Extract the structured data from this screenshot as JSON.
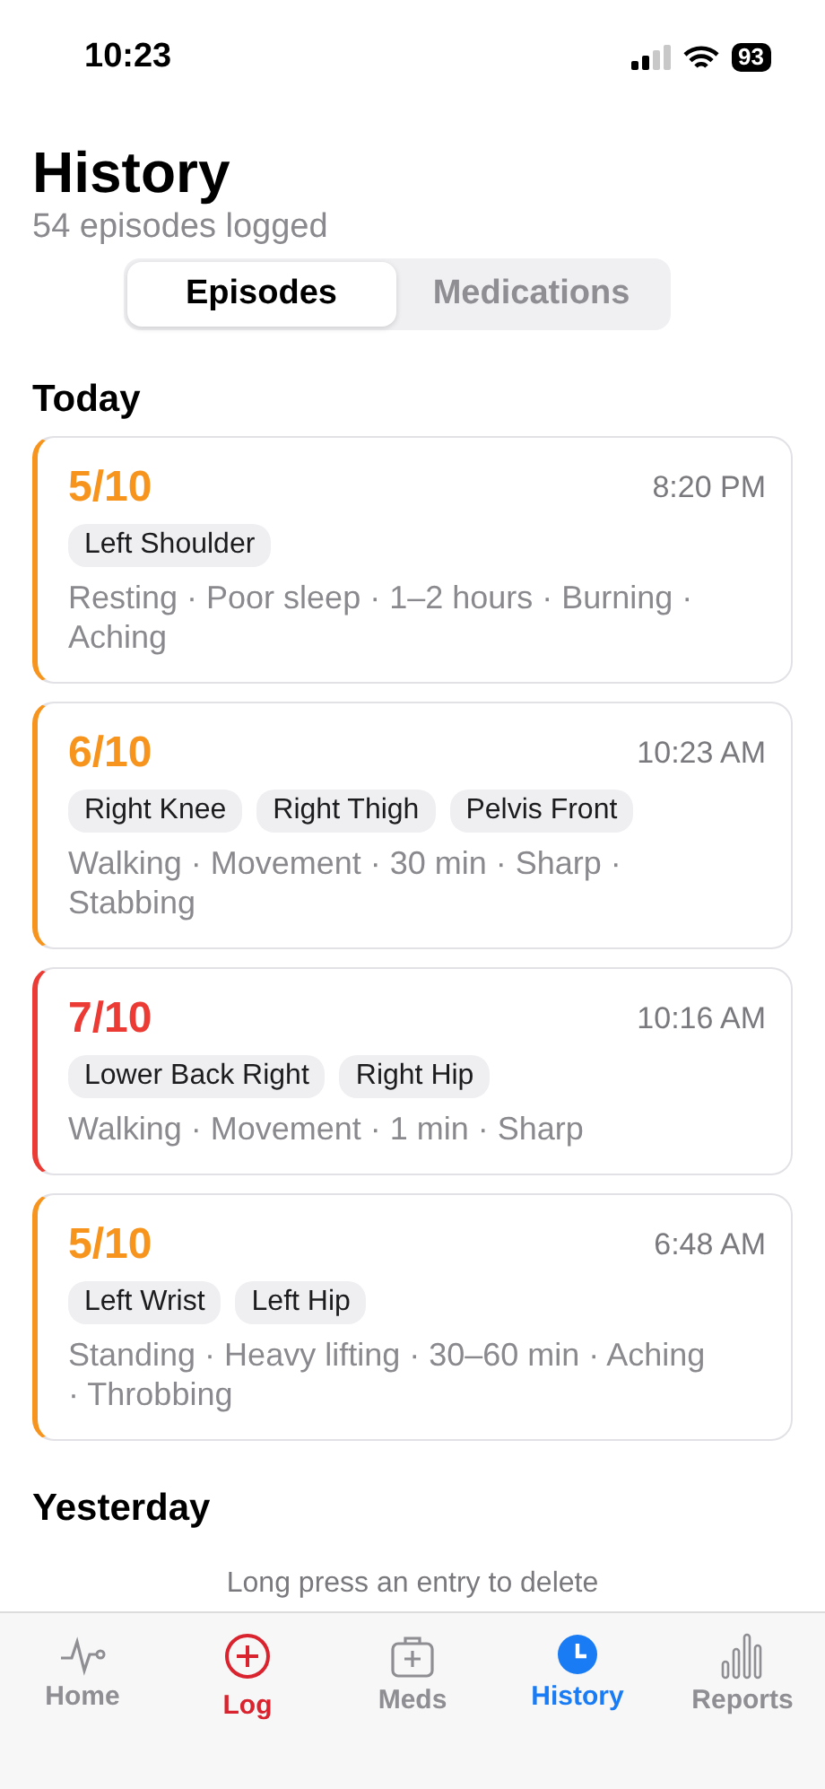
{
  "status_bar": {
    "time": "10:23",
    "battery": "93"
  },
  "header": {
    "title": "History",
    "subtitle": "54 episodes logged"
  },
  "segments": [
    {
      "label": "Episodes",
      "selected": true
    },
    {
      "label": "Medications",
      "selected": false
    }
  ],
  "sections": [
    {
      "title": "Today",
      "episodes": [
        {
          "score": "5/10",
          "color": "#f7941d",
          "time": "8:20 PM",
          "locations": [
            "Left Shoulder"
          ],
          "details": "Resting · Poor sleep · 1–2 hours · Burning · Aching"
        },
        {
          "score": "6/10",
          "color": "#f7941d",
          "time": "10:23 AM",
          "locations": [
            "Right Knee",
            "Right Thigh",
            "Pelvis Front"
          ],
          "details": "Walking · Movement · 30 min · Sharp · Stabbing"
        },
        {
          "score": "7/10",
          "color": "#eb3b34",
          "time": "10:16 AM",
          "locations": [
            "Lower Back Right",
            "Right Hip"
          ],
          "details": "Walking · Movement · 1 min · Sharp"
        },
        {
          "score": "5/10",
          "color": "#f7941d",
          "time": "6:48 AM",
          "locations": [
            "Left Wrist",
            "Left Hip"
          ],
          "details": "Standing · Heavy lifting · 30–60 min · Aching · Throbbing"
        }
      ]
    },
    {
      "title": "Yesterday"
    }
  ],
  "hint": "Long press an entry to delete",
  "tab_bar": [
    {
      "label": "Home",
      "kind": "pulse",
      "selected": false
    },
    {
      "label": "Log",
      "kind": "add",
      "selected": false
    },
    {
      "label": "Meds",
      "kind": "kit",
      "selected": false
    },
    {
      "label": "History",
      "kind": "clock",
      "selected": true
    },
    {
      "label": "Reports",
      "kind": "bars",
      "selected": false
    }
  ]
}
